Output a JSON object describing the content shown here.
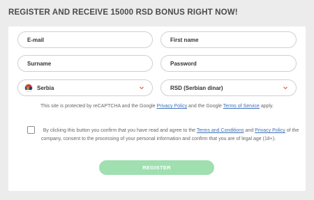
{
  "header": {
    "title": "REGISTER AND RECEIVE 15000 RSD BONUS RIGHT NOW!"
  },
  "form": {
    "email_placeholder": "E-mail",
    "first_name_placeholder": "First name",
    "surname_placeholder": "Surname",
    "password_placeholder": "Password",
    "country_value": "Serbia",
    "currency_value": "RSD (Serbian dinar)",
    "recaptcha": {
      "prefix": "This site is protected by reCAPTCHA and the Google ",
      "privacy_link": "Privacy Policy",
      "and": " and the Google ",
      "terms_link": "Terms of Service",
      "suffix": " apply."
    },
    "consent": {
      "part1": "By clicking this button you confirm that you have read and agree to the ",
      "terms_link": "Terms and Conditions",
      "and": " and ",
      "privacy_link": "Privacy Policy",
      "part2": " of the company, consent to the processing of your personal information and confirm that you are of legal age (18+)."
    },
    "checkbox_checked": false,
    "register_label": "REGISTER"
  },
  "icons": {
    "country_flag": "serbia-flag-icon",
    "dropdown": "chevron-down-icon"
  },
  "colors": {
    "register_button": "#9fdfb0",
    "link": "#3d6fb8",
    "chevron": "#e0564b"
  }
}
